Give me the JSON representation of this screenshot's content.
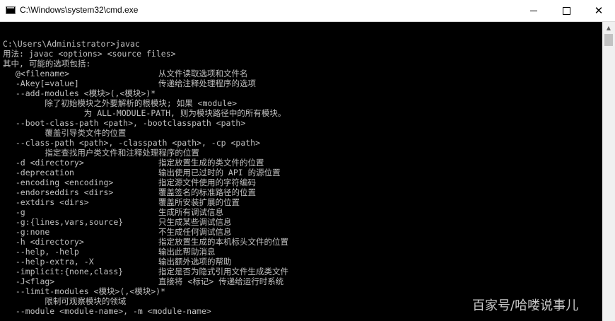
{
  "window": {
    "title": "C:\\Windows\\system32\\cmd.exe",
    "icon": "cmd-icon",
    "controls": {
      "minimize": "minimize-icon",
      "maximize": "maximize-icon",
      "close_glyph": "✕"
    }
  },
  "console": {
    "prompt": "C:\\Users\\Administrator>javac",
    "usage": "用法: javac <options> <source files>",
    "intro": "其中, 可能的选项包括:",
    "options": [
      {
        "opt": "  @<filename>",
        "desc": "从文件读取选项和文件名"
      },
      {
        "opt": "  -Akey[=value]",
        "desc": "传递给注释处理程序的选项"
      },
      {
        "opt": "  --add-modules <模块>(,<模块>)*",
        "desc": ""
      },
      {
        "opt": "        除了初始模块之外要解析的根模块; 如果 <module>",
        "desc": ""
      },
      {
        "opt": "                为 ALL-MODULE-PATH, 则为模块路径中的所有模块。",
        "desc": ""
      },
      {
        "opt": "  --boot-class-path <path>, -bootclasspath <path>",
        "desc": ""
      },
      {
        "opt": "        覆盖引导类文件的位置",
        "desc": ""
      },
      {
        "opt": "  --class-path <path>, -classpath <path>, -cp <path>",
        "desc": ""
      },
      {
        "opt": "        指定查找用户类文件和注释处理程序的位置",
        "desc": ""
      },
      {
        "opt": "  -d <directory>",
        "desc": "指定放置生成的类文件的位置"
      },
      {
        "opt": "  -deprecation",
        "desc": "输出使用已过时的 API 的源位置"
      },
      {
        "opt": "  -encoding <encoding>",
        "desc": "指定源文件使用的字符编码"
      },
      {
        "opt": "  -endorseddirs <dirs>",
        "desc": "覆盖签名的标准路径的位置"
      },
      {
        "opt": "  -extdirs <dirs>",
        "desc": "覆盖所安装扩展的位置"
      },
      {
        "opt": "  -g",
        "desc": "生成所有调试信息"
      },
      {
        "opt": "  -g:{lines,vars,source}",
        "desc": "只生成某些调试信息"
      },
      {
        "opt": "  -g:none",
        "desc": "不生成任何调试信息"
      },
      {
        "opt": "  -h <directory>",
        "desc": "指定放置生成的本机标头文件的位置"
      },
      {
        "opt": "  --help, -help",
        "desc": "输出此帮助消息"
      },
      {
        "opt": "  --help-extra, -X",
        "desc": "输出额外选项的帮助"
      },
      {
        "opt": "  -implicit:{none,class}",
        "desc": "指定是否为隐式引用文件生成类文件"
      },
      {
        "opt": "  -J<flag>",
        "desc": "直接将 <标记> 传递给运行时系统"
      },
      {
        "opt": "  --limit-modules <模块>(,<模块>)*",
        "desc": ""
      },
      {
        "opt": "        限制可观察模块的领域",
        "desc": ""
      },
      {
        "opt": "  --module <module-name>, -m <module-name>",
        "desc": ""
      }
    ],
    "text_color": "#c0c0c0",
    "background": "#000000"
  },
  "scrollbar": {
    "up_glyph": "▲"
  },
  "watermark": "百家号/哈喽说事儿"
}
